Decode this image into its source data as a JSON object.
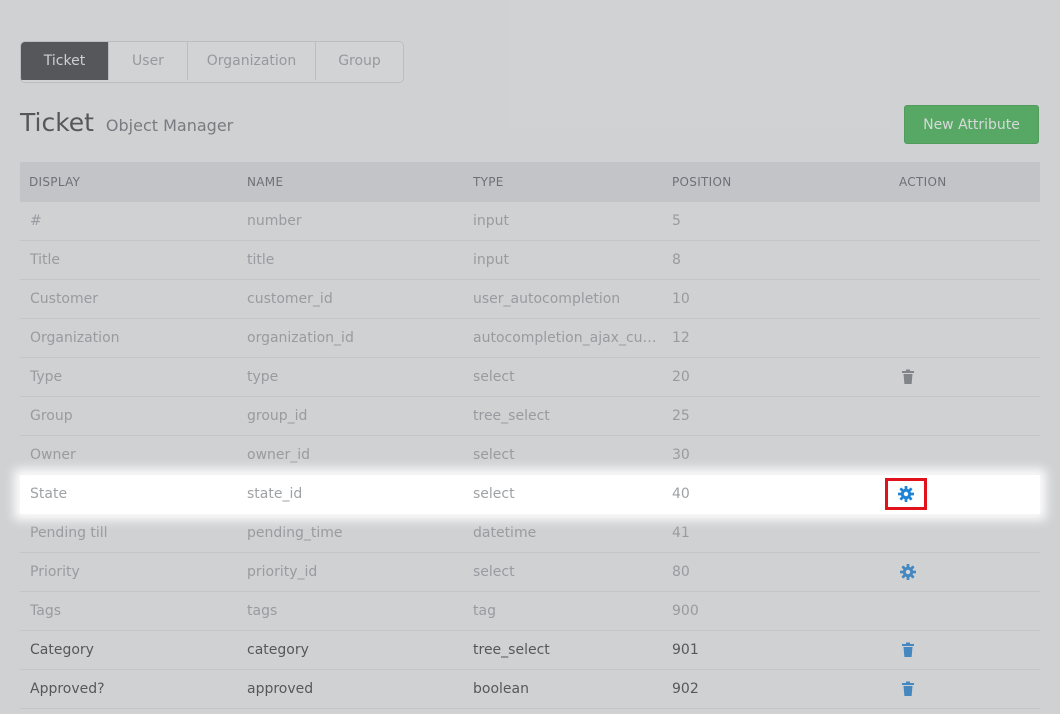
{
  "tabs": [
    "Ticket",
    "User",
    "Organization",
    "Group"
  ],
  "header": {
    "title": "Ticket",
    "subtitle": "Object Manager",
    "new_button": "New Attribute"
  },
  "columns": [
    "DISPLAY",
    "NAME",
    "TYPE",
    "POSITION",
    "ACTION"
  ],
  "rows": [
    {
      "display": "#",
      "name": "number",
      "type": "input",
      "position": "5",
      "action": ""
    },
    {
      "display": "Title",
      "name": "title",
      "type": "input",
      "position": "8",
      "action": ""
    },
    {
      "display": "Customer",
      "name": "customer_id",
      "type": "user_autocompletion",
      "position": "10",
      "action": ""
    },
    {
      "display": "Organization",
      "name": "organization_id",
      "type": "autocompletion_ajax_cust...",
      "position": "12",
      "action": ""
    },
    {
      "display": "Type",
      "name": "type",
      "type": "select",
      "position": "20",
      "action": "trash-icon"
    },
    {
      "display": "Group",
      "name": "group_id",
      "type": "tree_select",
      "position": "25",
      "action": ""
    },
    {
      "display": "Owner",
      "name": "owner_id",
      "type": "select",
      "position": "30",
      "action": ""
    },
    {
      "display": "State",
      "name": "state_id",
      "type": "select",
      "position": "40",
      "action": "gear-icon"
    },
    {
      "display": "Pending till",
      "name": "pending_time",
      "type": "datetime",
      "position": "41",
      "action": ""
    },
    {
      "display": "Priority",
      "name": "priority_id",
      "type": "select",
      "position": "80",
      "action": "gear-icon"
    },
    {
      "display": "Tags",
      "name": "tags",
      "type": "tag",
      "position": "900",
      "action": ""
    },
    {
      "display": "Category",
      "name": "category",
      "type": "tree_select",
      "position": "901",
      "action": "trash-icon"
    },
    {
      "display": "Approved?",
      "name": "approved",
      "type": "boolean",
      "position": "902",
      "action": "trash-icon"
    }
  ],
  "colors": {
    "accent_blue": "#1f83d6",
    "green": "#3ab54a",
    "highlight_border": "#e2121c",
    "icon_grey": "#7b7e82"
  }
}
